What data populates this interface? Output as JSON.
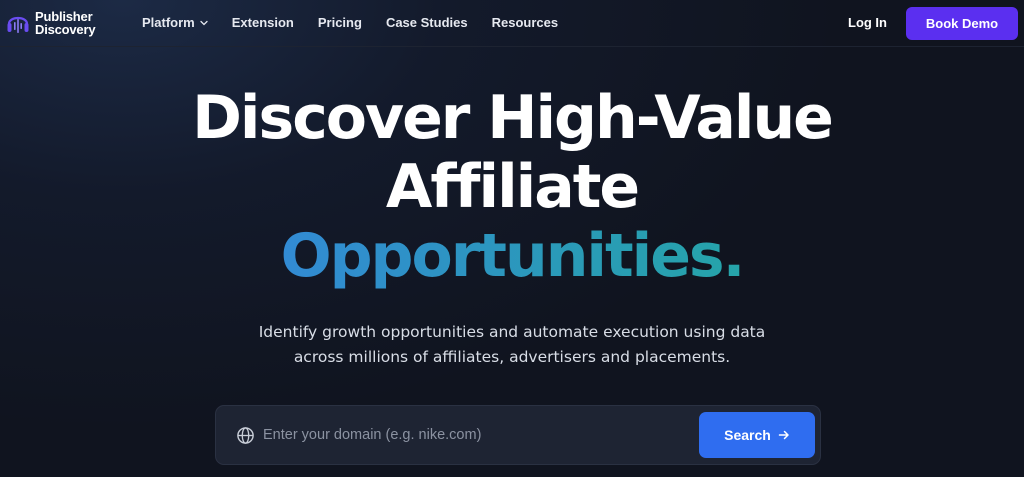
{
  "brand": {
    "line1": "Publisher",
    "line2": "Discovery",
    "logo_icon": "headphones-waveform-icon",
    "colors": {
      "logo_accent": "#5b3df0"
    }
  },
  "nav": {
    "items": [
      {
        "label": "Platform",
        "has_dropdown": true
      },
      {
        "label": "Extension"
      },
      {
        "label": "Pricing"
      },
      {
        "label": "Case Studies"
      },
      {
        "label": "Resources"
      }
    ],
    "login_label": "Log In",
    "cta_label": "Book Demo",
    "cta_color": "#5b2ff0"
  },
  "hero": {
    "title_line1": "Discover High-Value",
    "title_line2": "Affiliate",
    "title_highlight": "Opportunities.",
    "highlight_gradient": [
      "#3a7bf0",
      "#1fb491"
    ],
    "subtitle_line1": "Identify growth opportunities and automate execution using data",
    "subtitle_line2": "across millions of affiliates, advertisers and placements."
  },
  "search": {
    "icon": "globe-icon",
    "placeholder": "Enter your domain (e.g. nike.com)",
    "value": "",
    "button_label": "Search",
    "button_icon": "arrow-right-icon",
    "button_color": "#2f6df0"
  }
}
